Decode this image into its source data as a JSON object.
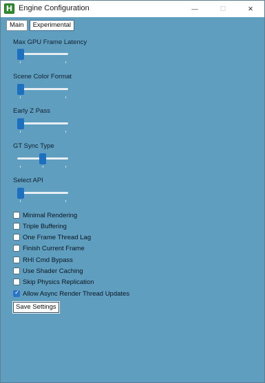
{
  "window": {
    "title": "Engine Configuration",
    "icon_letter": "H",
    "minimize_icon": "—",
    "maximize_icon": "☐",
    "close_icon": "✕"
  },
  "tabs": [
    {
      "label": "Main",
      "active": false
    },
    {
      "label": "Experimental",
      "active": true
    }
  ],
  "sliders": [
    {
      "label": "Max GPU Frame Latency",
      "value": 0
    },
    {
      "label": "Scene Color Format",
      "value": 0
    },
    {
      "label": "Early Z Pass",
      "value": 0
    },
    {
      "label": "GT Sync Type",
      "value": 0.5
    },
    {
      "label": "Select API",
      "value": 0
    }
  ],
  "checkboxes": [
    {
      "label": "Minimal Rendering",
      "checked": false
    },
    {
      "label": "Triple Buffering",
      "checked": false
    },
    {
      "label": "One Frame Thread Lag",
      "checked": false
    },
    {
      "label": "Finish Current Frame",
      "checked": false
    },
    {
      "label": "RHI Cmd Bypass",
      "checked": false
    },
    {
      "label": "Use Shader Caching",
      "checked": false
    },
    {
      "label": "Skip Physics Replication",
      "checked": false
    },
    {
      "label": "Allow Async Render Thread Updates",
      "checked": true
    }
  ],
  "save_button": {
    "label": "Save Settings"
  }
}
